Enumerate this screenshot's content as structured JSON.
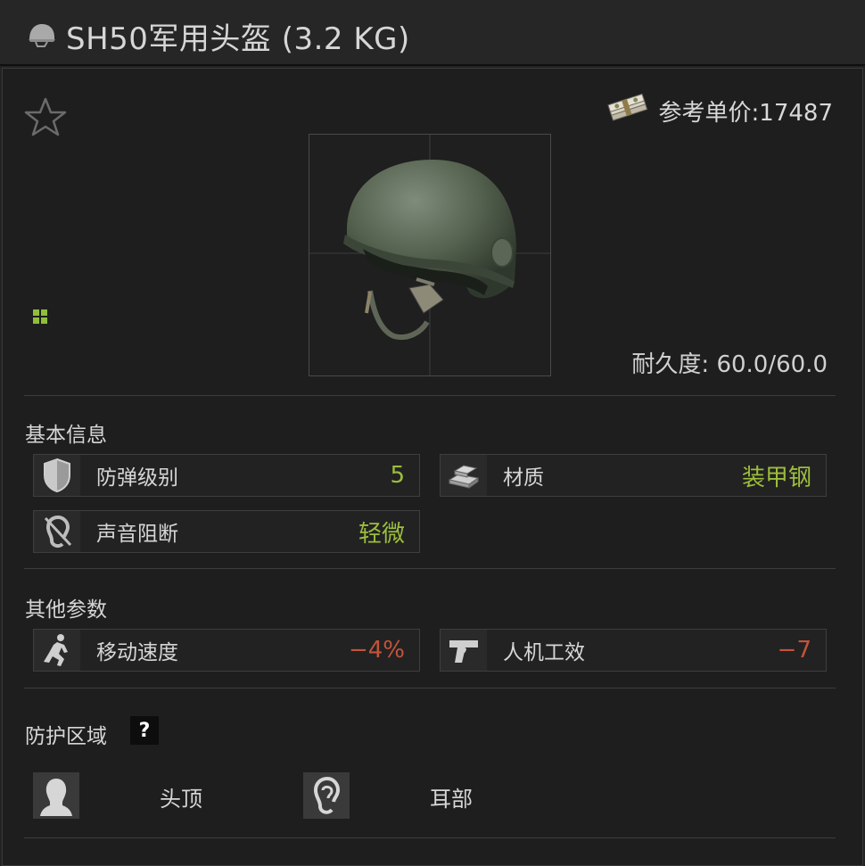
{
  "window": {
    "title": "SH50军用头盔 (3.2 KG)",
    "title_icon": "helmet-icon"
  },
  "item": {
    "favorite_icon": "star-outline-icon",
    "price_icon": "money-bundle-icon",
    "price_label": "参考单价:17487",
    "image": "helmet-image",
    "durability_label": "耐久度: 60.0/60.0",
    "size_icon": "grid-size-icon"
  },
  "basic_info": {
    "title": "基本信息",
    "stats": [
      {
        "label": "防弹级别",
        "value": "5",
        "icon": "shield-icon",
        "tone": "good"
      },
      {
        "label": "材质",
        "value": "装甲钢",
        "icon": "steel-ingots-icon",
        "tone": "good"
      },
      {
        "label": "声音阻断",
        "value": "轻微",
        "icon": "ear-blocked-icon",
        "tone": "good"
      }
    ]
  },
  "other_params": {
    "title": "其他参数",
    "stats": [
      {
        "label": "移动速度",
        "value": "−4%",
        "icon": "running-soldier-icon",
        "tone": "bad"
      },
      {
        "label": "人机工效",
        "value": "−7",
        "icon": "pistol-icon",
        "tone": "bad"
      }
    ]
  },
  "protection": {
    "title": "防护区域",
    "help_label": "?",
    "zones": [
      {
        "label": "头顶",
        "icon": "head-silhouette-icon"
      },
      {
        "label": "耳部",
        "icon": "ear-icon"
      }
    ]
  },
  "colors": {
    "good": "#9cbd3c",
    "bad": "#c2543a",
    "background": "#1e1e1e"
  }
}
